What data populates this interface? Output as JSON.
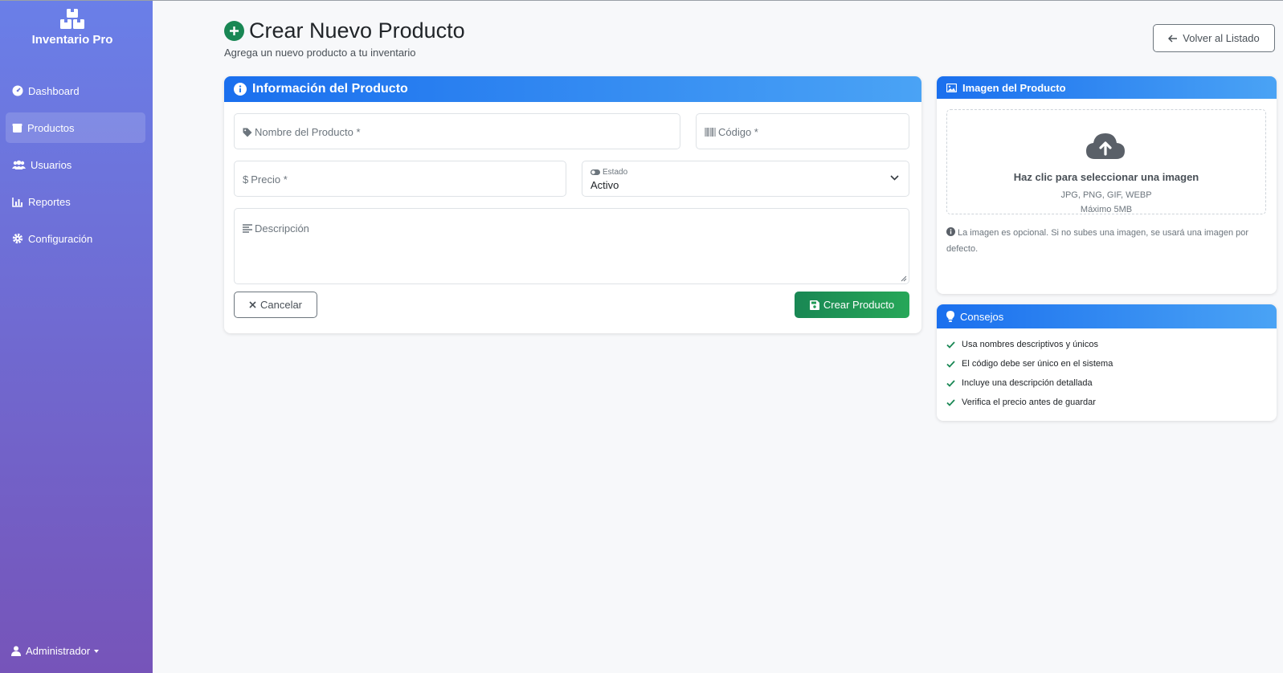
{
  "app": {
    "name": "Inventario Pro"
  },
  "sidebar": {
    "items": [
      {
        "label": "Dashboard",
        "icon": "dashboard-icon"
      },
      {
        "label": "Productos",
        "icon": "box-icon",
        "active": true
      },
      {
        "label": "Usuarios",
        "icon": "users-icon"
      },
      {
        "label": "Reportes",
        "icon": "chart-icon"
      },
      {
        "label": "Configuración",
        "icon": "gear-icon"
      }
    ],
    "user": "Administrador"
  },
  "header": {
    "title": "Crear Nuevo Producto",
    "subtitle": "Agrega un nuevo producto a tu inventario",
    "back_label": "Volver al Listado"
  },
  "form": {
    "title": "Información del Producto",
    "name_placeholder": "Nombre del Producto *",
    "code_placeholder": "Código *",
    "price_placeholder": "Precio *",
    "status_label": "Estado",
    "status_value": "Activo",
    "description_placeholder": "Descripción",
    "cancel_label": "Cancelar",
    "submit_label": "Crear Producto"
  },
  "image_card": {
    "title": "Imagen del Producto",
    "upload_title": "Haz clic para seleccionar una imagen",
    "formats": "JPG, PNG, GIF, WEBP",
    "max_size": "Máximo 5MB",
    "note": "La imagen es opcional. Si no subes una imagen, se usará una imagen por defecto."
  },
  "tips_card": {
    "title": "Consejos",
    "items": [
      "Usa nombres descriptivos y únicos",
      "El código debe ser único en el sistema",
      "Incluye una descripción detallada",
      "Verifica el precio antes de guardar"
    ]
  },
  "colors": {
    "sidebar_top": "#6a7fe8",
    "sidebar_bottom": "#7654b9",
    "primary": "#1a6fee",
    "success": "#198754"
  }
}
